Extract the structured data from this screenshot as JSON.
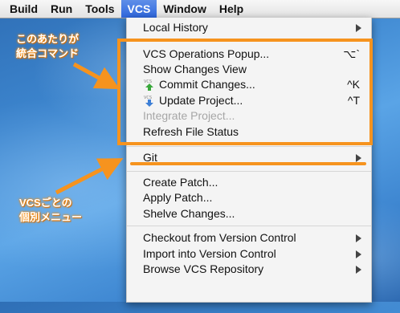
{
  "menubar": {
    "items": [
      {
        "label": "Build"
      },
      {
        "label": "Run"
      },
      {
        "label": "Tools"
      },
      {
        "label": "VCS"
      },
      {
        "label": "Window"
      },
      {
        "label": "Help"
      }
    ],
    "active": "VCS"
  },
  "menu": {
    "local_history": "Local History",
    "vcs_operations_popup": {
      "label": "VCS Operations Popup...",
      "shortcut": "⌥`"
    },
    "show_changes_view": "Show Changes View",
    "commit_changes": {
      "label": "Commit Changes...",
      "shortcut": "^K",
      "icon": "commit-icon"
    },
    "update_project": {
      "label": "Update Project...",
      "shortcut": "^T",
      "icon": "update-icon"
    },
    "integrate_project": "Integrate Project...",
    "refresh_file_status": "Refresh File Status",
    "git": "Git",
    "create_patch": "Create Patch...",
    "apply_patch": "Apply Patch...",
    "shelve_changes": "Shelve Changes...",
    "checkout_from_vc": "Checkout from Version Control",
    "import_into_vc": "Import into Version Control",
    "browse_vcs_repo": "Browse VCS Repository"
  },
  "callouts": {
    "c1_line1": "このあたりが",
    "c1_line2": "統合コマンド",
    "c2_line1": "VCSごとの",
    "c2_line2": "個別メニュー"
  },
  "colors": {
    "highlight": "#f6931e",
    "menubar_active": "#2f67de"
  }
}
